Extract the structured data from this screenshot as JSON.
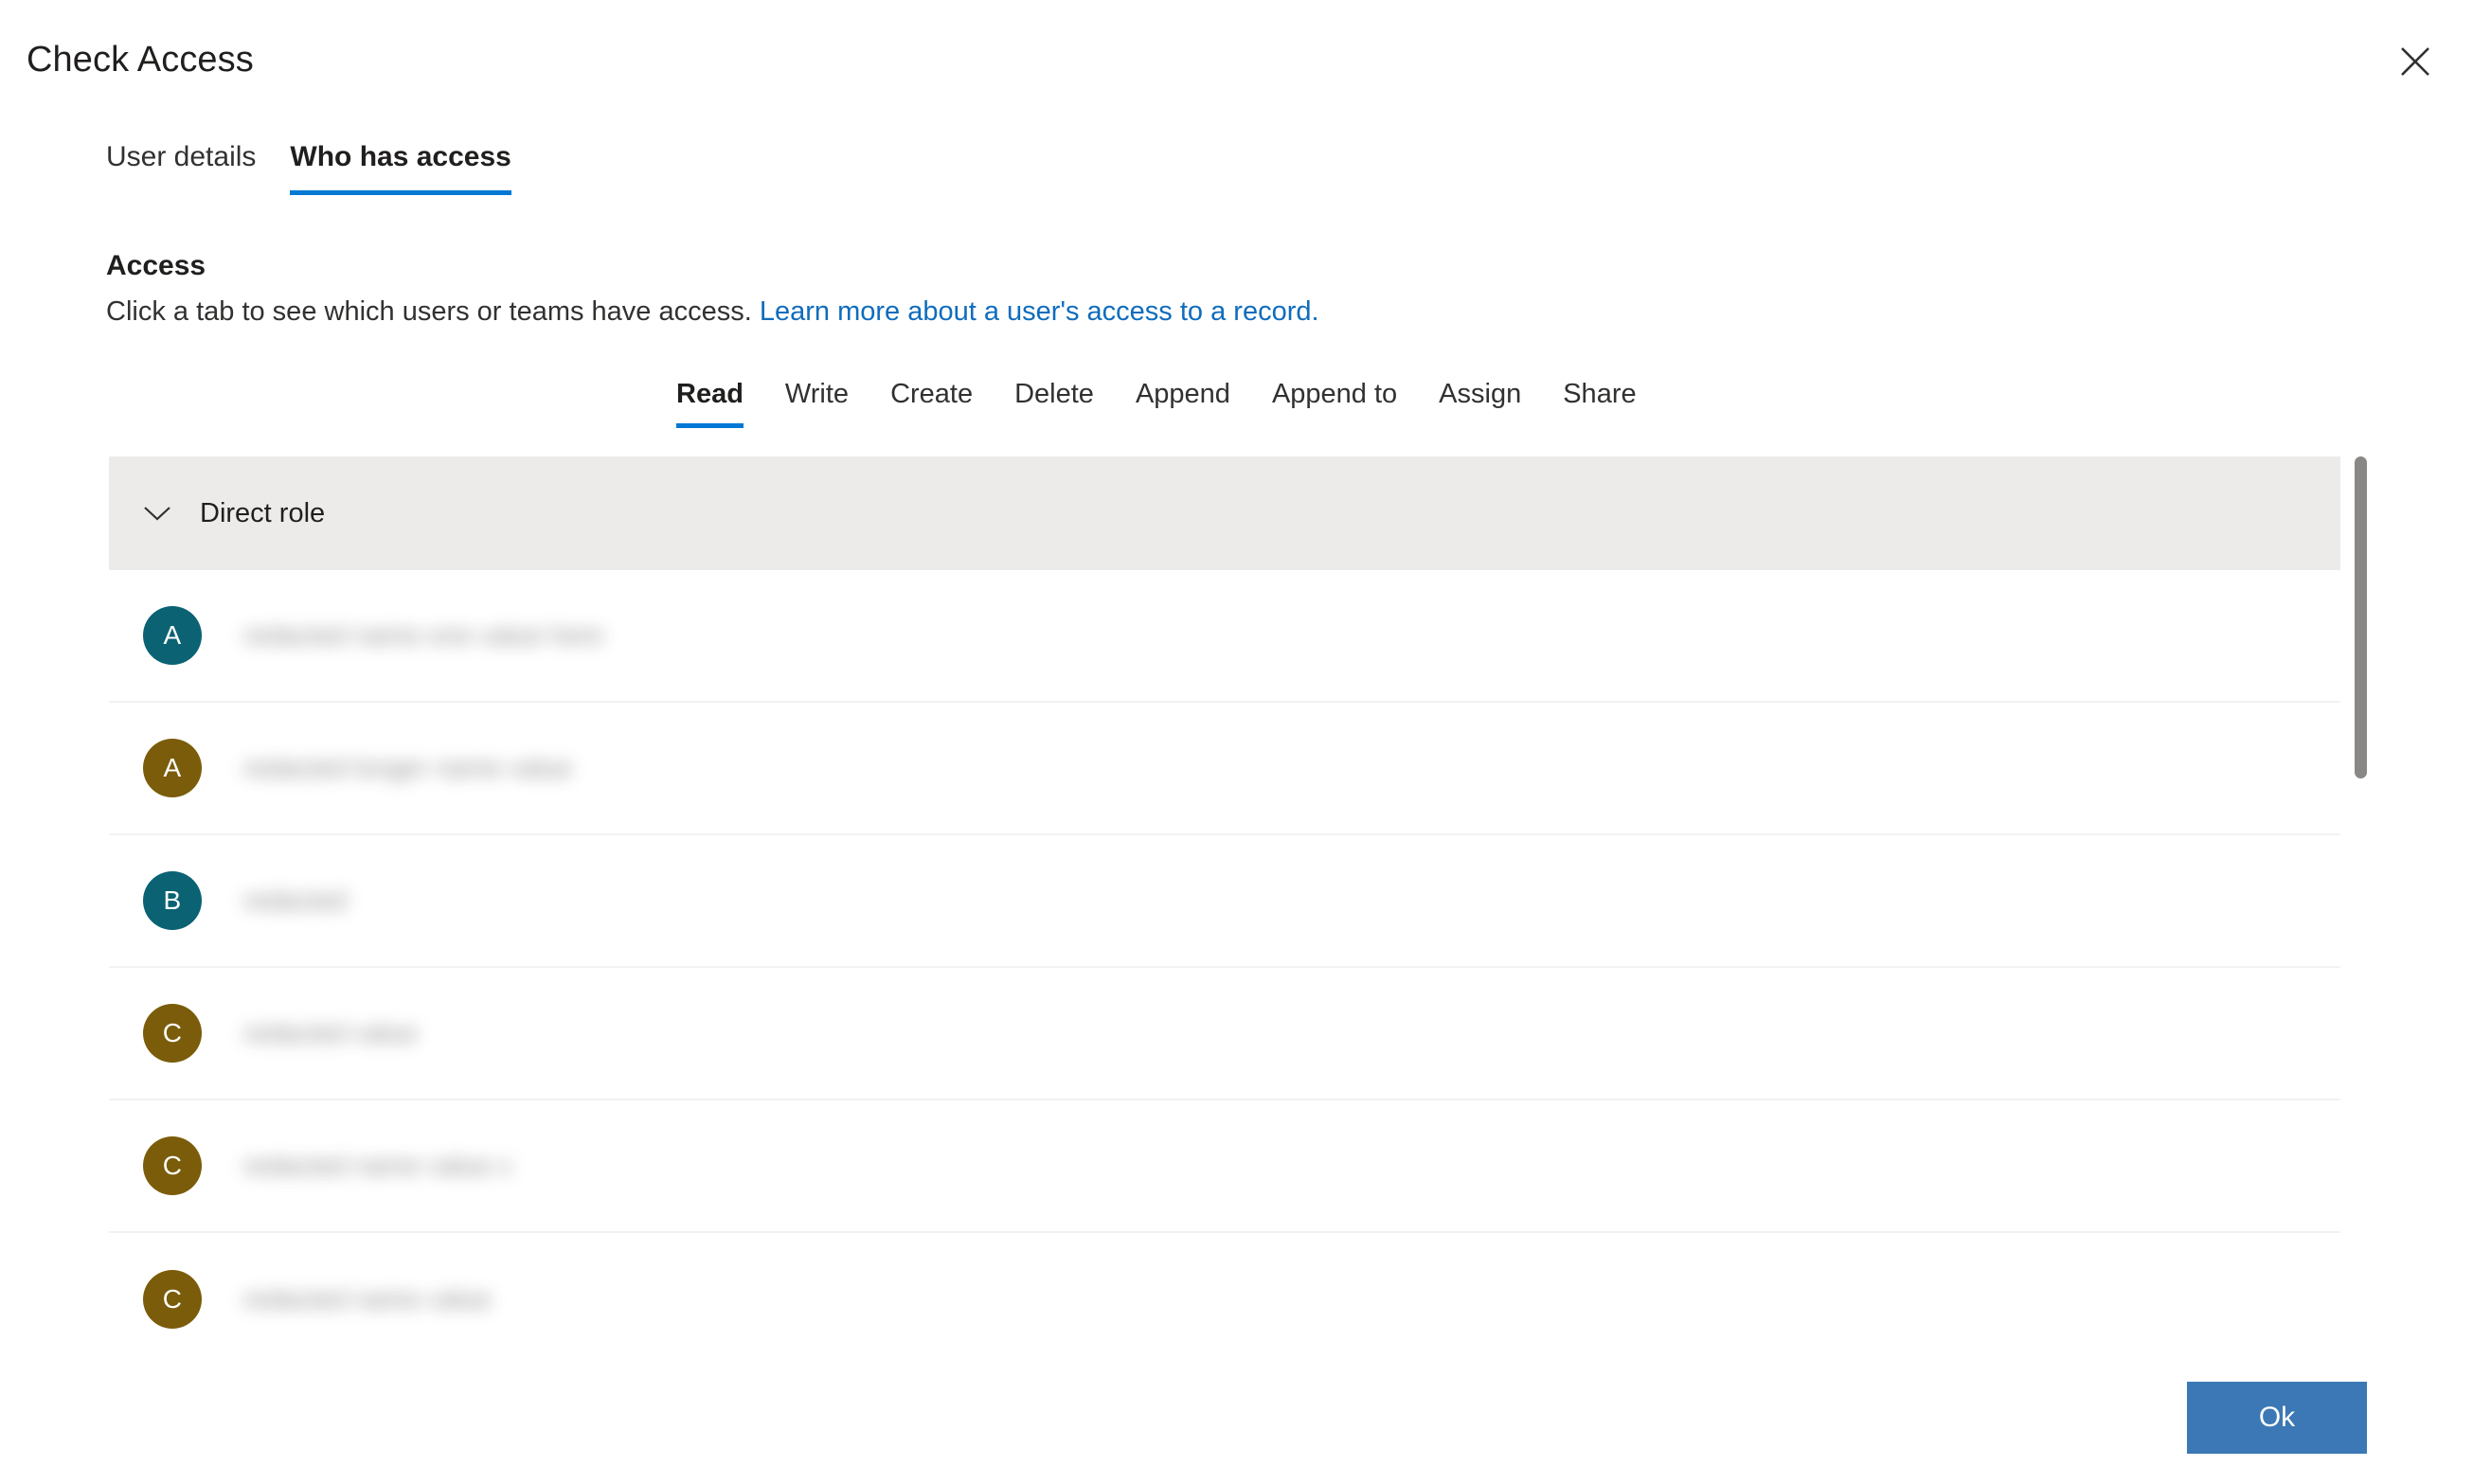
{
  "dialog": {
    "title": "Check Access",
    "close_label": "Close",
    "close_icon": "close-icon"
  },
  "theme": {
    "accent": "#0078d4",
    "link": "#0f6cbd",
    "group_header_bg": "#edebe9",
    "primary_button_bg": "#3b78b5",
    "avatar_teal": "#0a6273",
    "avatar_olive": "#7a5c0a",
    "row_divider": "#f3f2f1",
    "scrollbar_thumb": "#8a8886"
  },
  "pivots": [
    {
      "label": "User details",
      "selected": false
    },
    {
      "label": "Who has access",
      "selected": true
    }
  ],
  "access": {
    "heading": "Access",
    "description": "Click a tab to see which users or teams have access.",
    "link_text": "Learn more about a user's access to a record."
  },
  "privilege_tabs": [
    {
      "label": "Read",
      "selected": true
    },
    {
      "label": "Write",
      "selected": false
    },
    {
      "label": "Create",
      "selected": false
    },
    {
      "label": "Delete",
      "selected": false
    },
    {
      "label": "Append",
      "selected": false
    },
    {
      "label": "Append to",
      "selected": false
    },
    {
      "label": "Assign",
      "selected": false
    },
    {
      "label": "Share",
      "selected": false
    }
  ],
  "group": {
    "label": "Direct role",
    "expanded": true,
    "chevron_icon": "chevron-down-icon"
  },
  "rows": [
    {
      "initial": "A",
      "color": "#0a6273",
      "name": "redacted name one value here",
      "redacted": true
    },
    {
      "initial": "A",
      "color": "#7a5c0a",
      "name": "redacted longer name value",
      "redacted": true
    },
    {
      "initial": "B",
      "color": "#0a6273",
      "name": "redacted",
      "redacted": true
    },
    {
      "initial": "C",
      "color": "#7a5c0a",
      "name": "redacted value",
      "redacted": true
    },
    {
      "initial": "C",
      "color": "#7a5c0a",
      "name": "redacted name value x",
      "redacted": true
    },
    {
      "initial": "C",
      "color": "#7a5c0a",
      "name": "redacted name value",
      "redacted": true
    }
  ],
  "footer": {
    "ok_label": "Ok"
  }
}
